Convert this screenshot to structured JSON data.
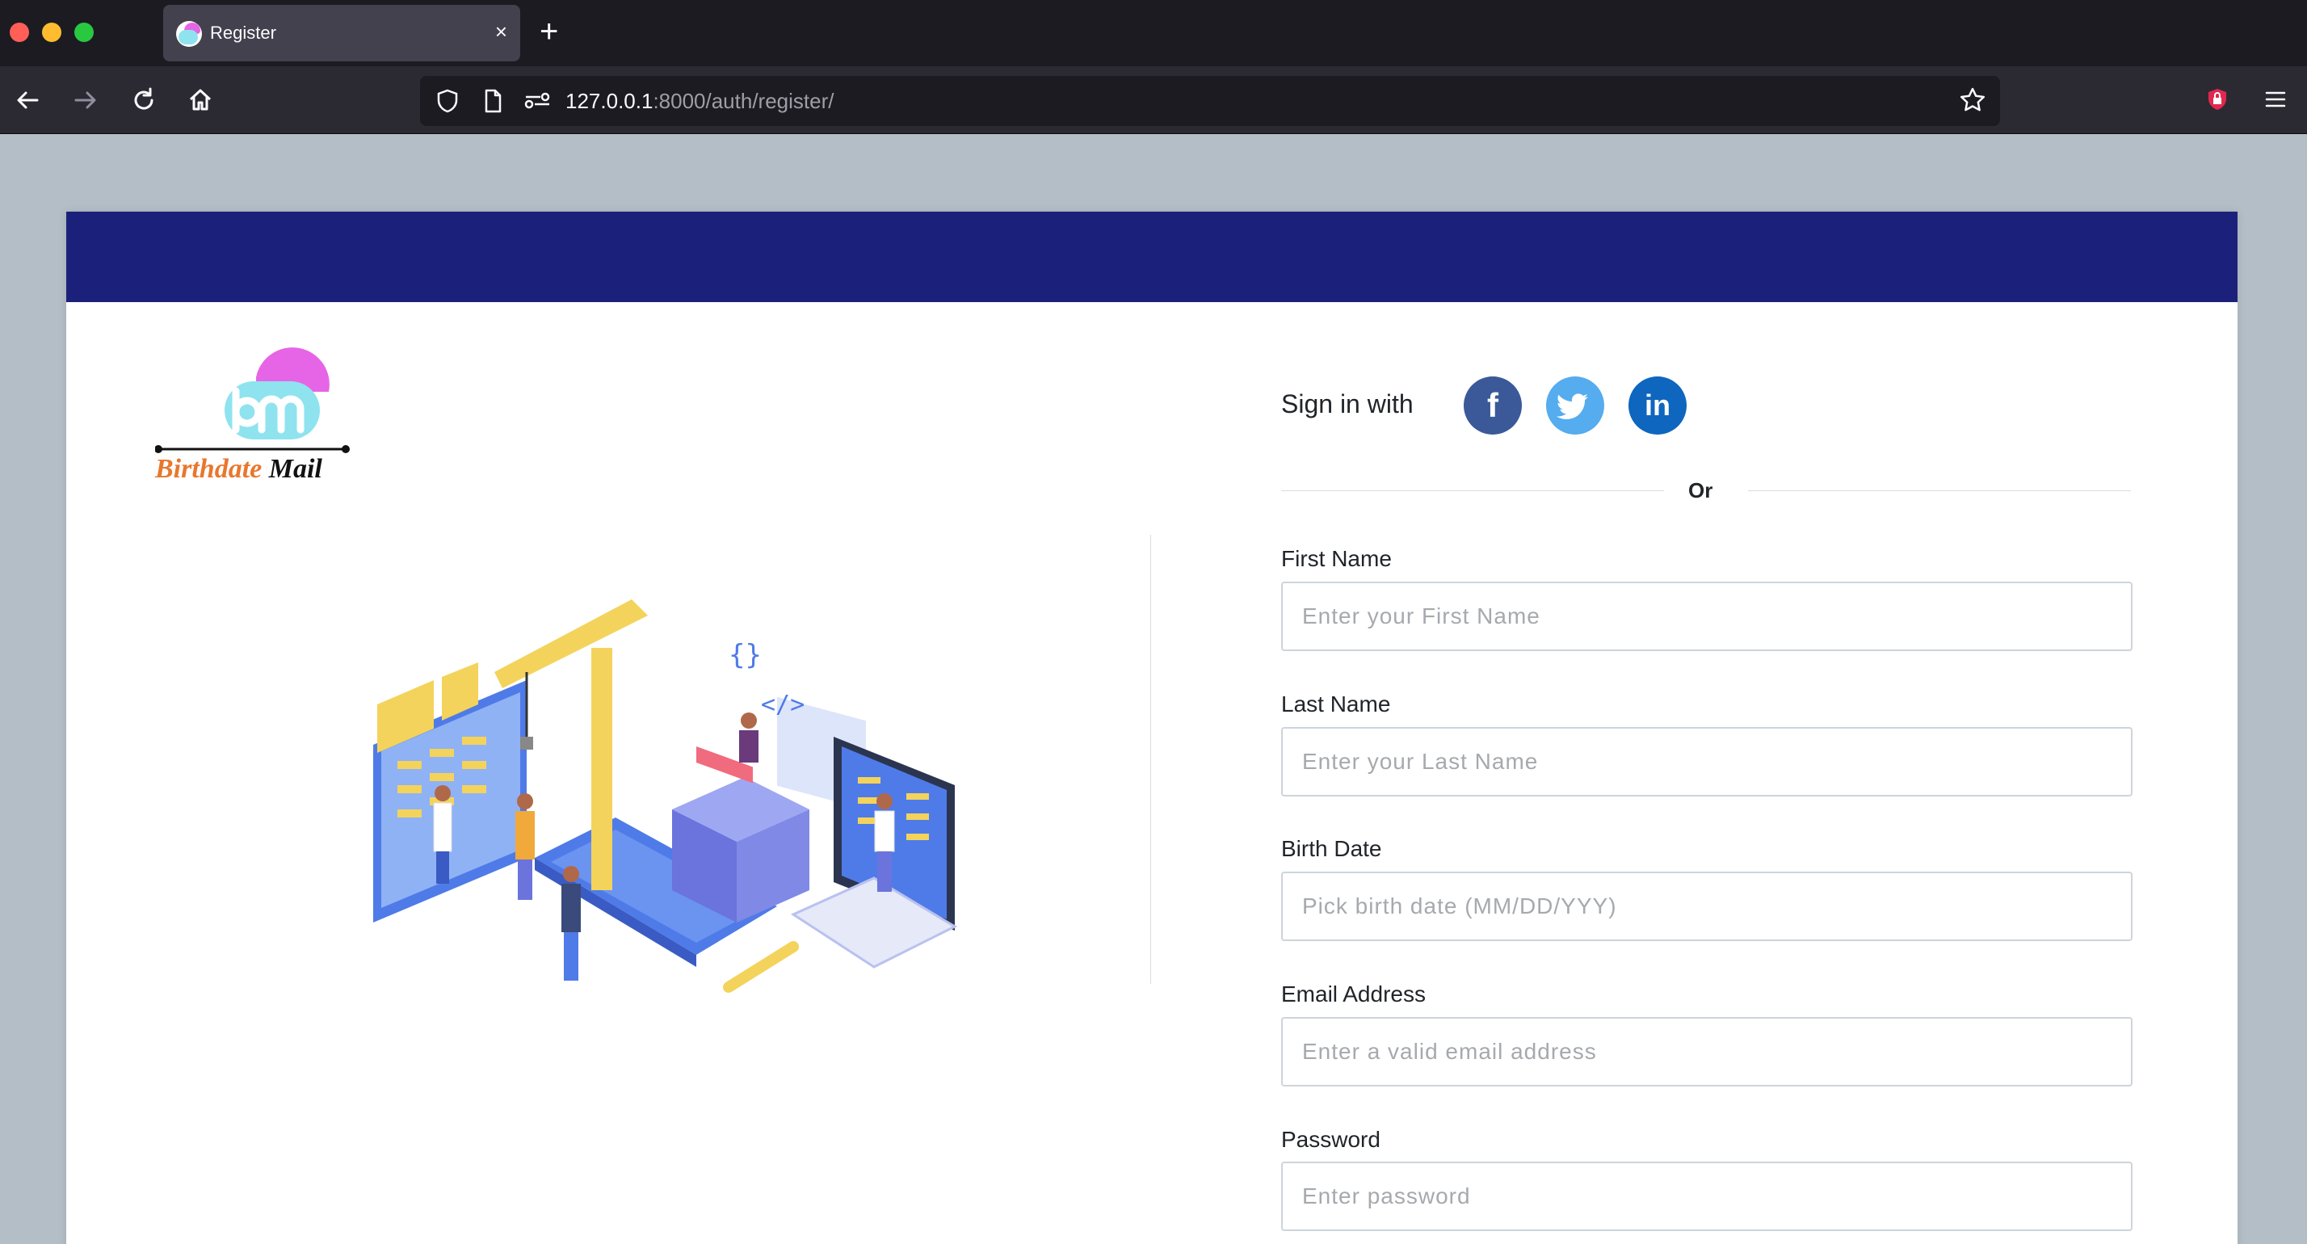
{
  "browser": {
    "tab_title": "Register",
    "tab_close": "×",
    "new_tab": "+",
    "url_host": "127.0.0.1",
    "url_rest": ":8000/auth/register/",
    "icons": [
      "back-icon",
      "forward-icon",
      "reload-icon",
      "home-icon",
      "shield-icon",
      "page-icon",
      "permissions-icon",
      "bookmark-star-icon",
      "extension-icon",
      "menu-icon"
    ]
  },
  "brand": {
    "word1": "Birthdate",
    "word2": "Mail",
    "logo_letters": "bm",
    "colors": {
      "pink": "#e665e6",
      "cyan": "#8ee3ef",
      "orange": "#e8772e"
    }
  },
  "header": {
    "color": "#1b217a"
  },
  "signin": {
    "label": "Sign in with",
    "facebook": "f",
    "linkedin": "in",
    "or": "Or"
  },
  "form": {
    "first_name": {
      "label": "First Name",
      "placeholder": "Enter your First Name"
    },
    "last_name": {
      "label": "Last Name",
      "placeholder": "Enter your Last Name"
    },
    "birth_date": {
      "label": "Birth Date",
      "placeholder": "Pick birth date (MM/DD/YYY)"
    },
    "email": {
      "label": "Email Address",
      "placeholder": "Enter a valid email address"
    },
    "password": {
      "label": "Password",
      "placeholder": "Enter password"
    }
  }
}
